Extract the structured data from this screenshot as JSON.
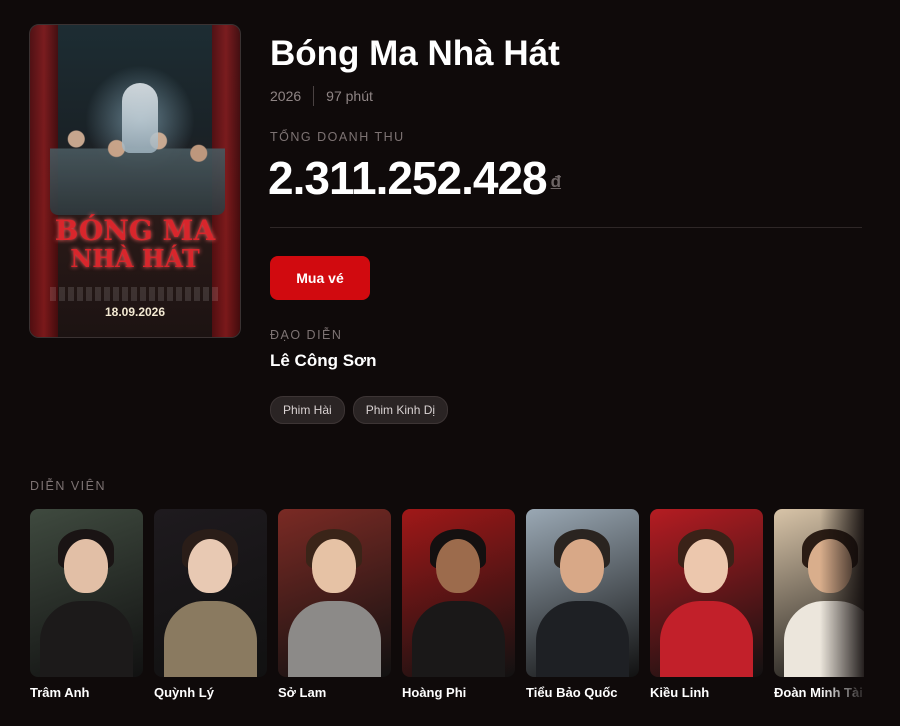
{
  "movie": {
    "title": "Bóng Ma Nhà Hát",
    "year": "2026",
    "duration": "97 phút",
    "poster": {
      "title_line1": "BÓNG MA",
      "title_line2": "NHÀ HÁT",
      "release_date": "18.09.2026"
    }
  },
  "revenue": {
    "label": "TỔNG DOANH THU",
    "amount": "2.311.252.428",
    "currency": "đ"
  },
  "actions": {
    "buy_label": "Mua vé"
  },
  "director": {
    "label": "ĐẠO DIỄN",
    "name": "Lê Công Sơn"
  },
  "genres": [
    "Phim Hài",
    "Phim Kinh Dị"
  ],
  "cast": {
    "label": "DIỄN VIÊN",
    "members": [
      {
        "name": "Trâm Anh",
        "bg": "#3f4a3f",
        "skin": "#e2bfa6",
        "hair": "#1a1414",
        "outfit": "#1c1a1a"
      },
      {
        "name": "Quỳnh Lý",
        "bg": "#1e1a1e",
        "skin": "#e8c9b3",
        "hair": "#2a1d18",
        "outfit": "#8a7a60"
      },
      {
        "name": "Sở Lam",
        "bg": "#7a2a24",
        "skin": "#e6c2a5",
        "hair": "#3a2418",
        "outfit": "#8c8a88"
      },
      {
        "name": "Hoàng Phi",
        "bg": "#a01818",
        "skin": "#9c6b4c",
        "hair": "#141010",
        "outfit": "#1a1818"
      },
      {
        "name": "Tiểu Bảo Quốc",
        "bg": "#9aa8b4",
        "skin": "#d8a887",
        "hair": "#2a2420",
        "outfit": "#1e2024"
      },
      {
        "name": "Kiều Linh",
        "bg": "#b51c22",
        "skin": "#ecc7ad",
        "hair": "#3a2218",
        "outfit": "#c2202a"
      },
      {
        "name": "Đoàn Minh Tài",
        "bg": "#d8c4a8",
        "skin": "#d9ae8c",
        "hair": "#2a1c14",
        "outfit": "#ece6dc"
      }
    ]
  }
}
